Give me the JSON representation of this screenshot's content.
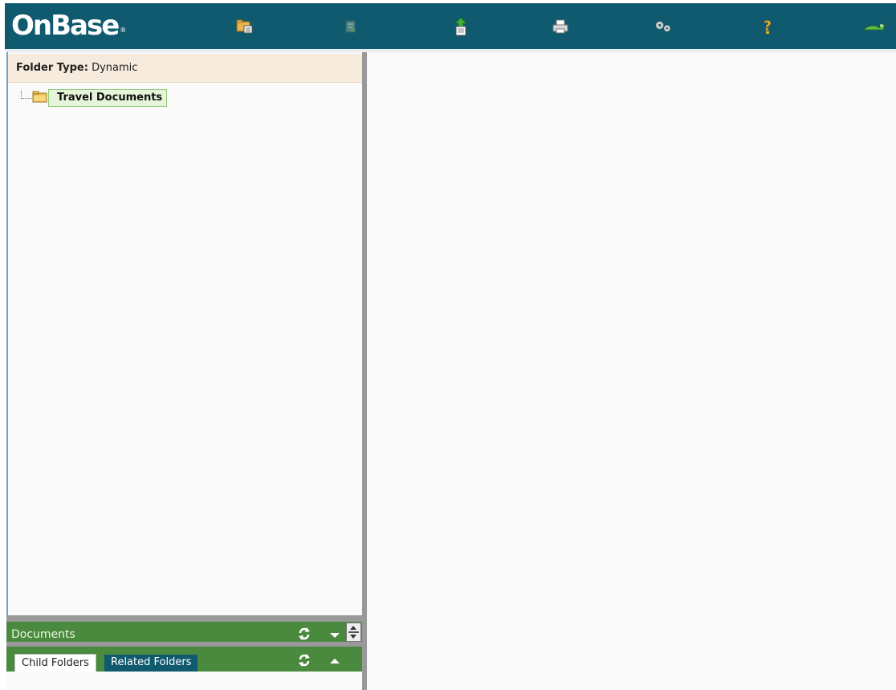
{
  "header": {
    "logo_text": "OnBase",
    "logo_mark": "®",
    "background": "#0f5a6e",
    "toolbar": [
      {
        "name": "open-folder-icon"
      },
      {
        "name": "retrieve-document-icon"
      },
      {
        "name": "upload-document-icon"
      },
      {
        "name": "print-icon"
      },
      {
        "name": "settings-gears-icon"
      },
      {
        "name": "help-icon"
      },
      {
        "name": "exit-icon"
      }
    ]
  },
  "folder_panel": {
    "folder_type_label": "Folder Type:",
    "folder_type_value": "Dynamic",
    "tree": [
      {
        "label": "Travel Documents",
        "selected": true
      }
    ]
  },
  "documents_bar": {
    "label": "Documents"
  },
  "folders_bar": {
    "tabs": [
      {
        "label": "Child Folders",
        "active": true
      },
      {
        "label": "Related Folders",
        "active": false
      }
    ]
  },
  "colors": {
    "accent_green": "#4a8a3f",
    "brand_teal": "#0f5a6e",
    "selection_bg": "#e6f5d9"
  }
}
